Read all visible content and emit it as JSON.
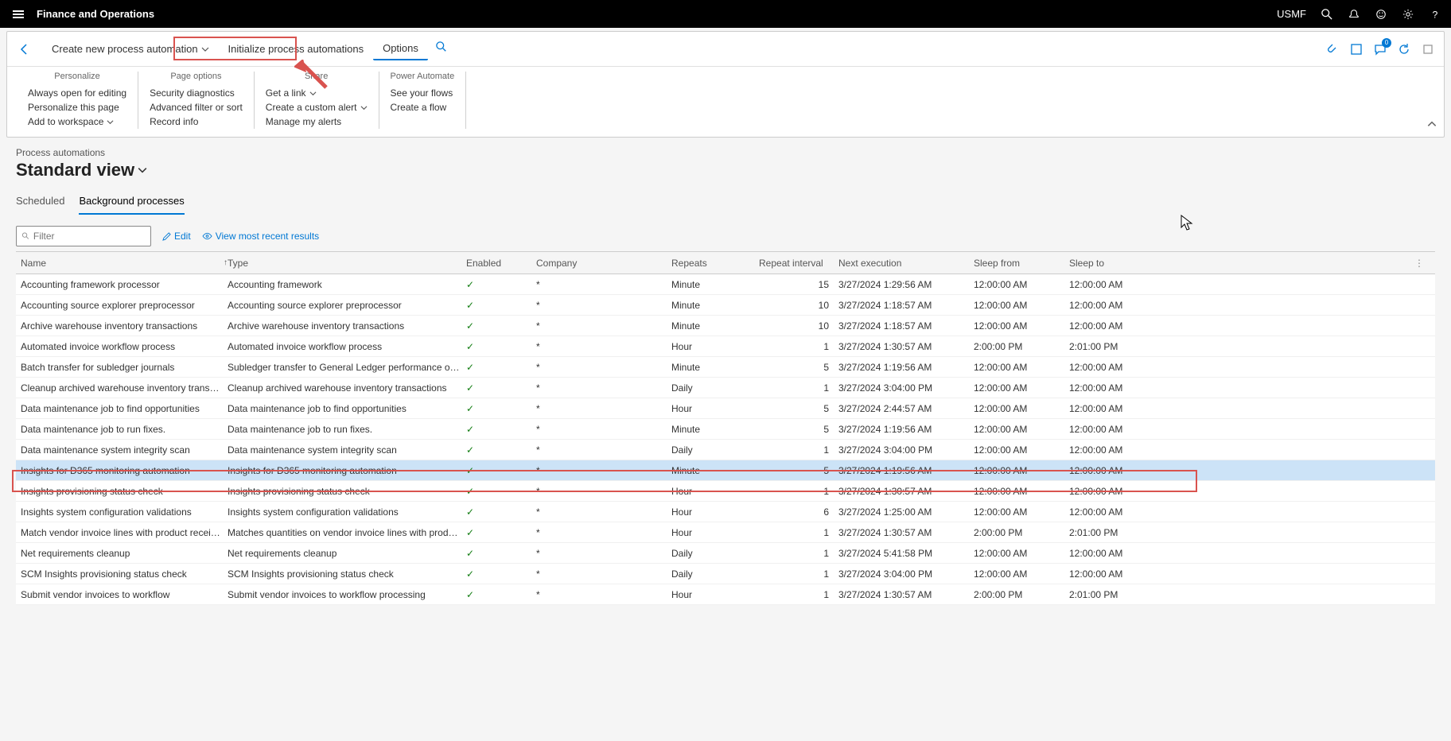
{
  "header": {
    "title": "Finance and Operations",
    "company": "USMF"
  },
  "actionPane": {
    "create": "Create new process automation",
    "initialize": "Initialize process automations",
    "options": "Options",
    "badge": "0"
  },
  "ribbon": {
    "personalize": {
      "title": "Personalize",
      "items": [
        "Always open for editing",
        "Personalize this page",
        "Add to workspace"
      ]
    },
    "pageOptions": {
      "title": "Page options",
      "items": [
        "Security diagnostics",
        "Advanced filter or sort",
        "Record info"
      ]
    },
    "share": {
      "title": "Share",
      "items": [
        "Get a link",
        "Create a custom alert",
        "Manage my alerts"
      ]
    },
    "powerAutomate": {
      "title": "Power Automate",
      "items": [
        "See your flows",
        "Create a flow"
      ]
    }
  },
  "body": {
    "breadcrumb": "Process automations",
    "viewTitle": "Standard view",
    "tabs": {
      "scheduled": "Scheduled",
      "background": "Background processes"
    },
    "filterPlaceholder": "Filter",
    "editLabel": "Edit",
    "recentLabel": "View most recent results"
  },
  "columns": {
    "name": "Name",
    "type": "Type",
    "enabled": "Enabled",
    "company": "Company",
    "repeats": "Repeats",
    "interval": "Repeat interval",
    "next": "Next execution",
    "sleepFrom": "Sleep from",
    "sleepTo": "Sleep to"
  },
  "rows": [
    {
      "name": "Accounting framework processor",
      "type": "Accounting framework",
      "enabled": true,
      "company": "*",
      "repeats": "Minute",
      "interval": "15",
      "next": "3/27/2024 1:29:56 AM",
      "sleepFrom": "12:00:00 AM",
      "sleepTo": "12:00:00 AM"
    },
    {
      "name": "Accounting source explorer preprocessor",
      "type": "Accounting source explorer preprocessor",
      "enabled": true,
      "company": "*",
      "repeats": "Minute",
      "interval": "10",
      "next": "3/27/2024 1:18:57 AM",
      "sleepFrom": "12:00:00 AM",
      "sleepTo": "12:00:00 AM"
    },
    {
      "name": "Archive warehouse inventory transactions",
      "type": "Archive warehouse inventory transactions",
      "enabled": true,
      "company": "*",
      "repeats": "Minute",
      "interval": "10",
      "next": "3/27/2024 1:18:57 AM",
      "sleepFrom": "12:00:00 AM",
      "sleepTo": "12:00:00 AM"
    },
    {
      "name": "Automated invoice workflow process",
      "type": "Automated invoice workflow process",
      "enabled": true,
      "company": "*",
      "repeats": "Hour",
      "interval": "1",
      "next": "3/27/2024 1:30:57 AM",
      "sleepFrom": "2:00:00 PM",
      "sleepTo": "2:01:00 PM"
    },
    {
      "name": "Batch transfer for subledger journals",
      "type": "Subledger transfer to General Ledger performance optimiza...",
      "enabled": true,
      "company": "*",
      "repeats": "Minute",
      "interval": "5",
      "next": "3/27/2024 1:19:56 AM",
      "sleepFrom": "12:00:00 AM",
      "sleepTo": "12:00:00 AM"
    },
    {
      "name": "Cleanup archived warehouse inventory transactions",
      "type": "Cleanup archived warehouse inventory transactions",
      "enabled": true,
      "company": "*",
      "repeats": "Daily",
      "interval": "1",
      "next": "3/27/2024 3:04:00 PM",
      "sleepFrom": "12:00:00 AM",
      "sleepTo": "12:00:00 AM"
    },
    {
      "name": "Data maintenance job to find opportunities",
      "type": "Data maintenance job to find opportunities",
      "enabled": true,
      "company": "*",
      "repeats": "Hour",
      "interval": "5",
      "next": "3/27/2024 2:44:57 AM",
      "sleepFrom": "12:00:00 AM",
      "sleepTo": "12:00:00 AM"
    },
    {
      "name": "Data maintenance job to run fixes.",
      "type": "Data maintenance job to run fixes.",
      "enabled": true,
      "company": "*",
      "repeats": "Minute",
      "interval": "5",
      "next": "3/27/2024 1:19:56 AM",
      "sleepFrom": "12:00:00 AM",
      "sleepTo": "12:00:00 AM"
    },
    {
      "name": "Data maintenance system integrity scan",
      "type": "Data maintenance system integrity scan",
      "enabled": true,
      "company": "*",
      "repeats": "Daily",
      "interval": "1",
      "next": "3/27/2024 3:04:00 PM",
      "sleepFrom": "12:00:00 AM",
      "sleepTo": "12:00:00 AM"
    },
    {
      "name": "Insights for D365 monitoring automation",
      "type": "Insights for D365 monitoring automation",
      "enabled": true,
      "company": "*",
      "repeats": "Minute",
      "interval": "5",
      "next": "3/27/2024 1:19:56 AM",
      "sleepFrom": "12:00:00 AM",
      "sleepTo": "12:00:00 AM",
      "highlighted": true
    },
    {
      "name": "Insights provisioning status check",
      "type": "Insights provisioning status check",
      "enabled": true,
      "company": "*",
      "repeats": "Hour",
      "interval": "1",
      "next": "3/27/2024 1:30:57 AM",
      "sleepFrom": "12:00:00 AM",
      "sleepTo": "12:00:00 AM"
    },
    {
      "name": "Insights system configuration validations",
      "type": "Insights system configuration validations",
      "enabled": true,
      "company": "*",
      "repeats": "Hour",
      "interval": "6",
      "next": "3/27/2024 1:25:00 AM",
      "sleepFrom": "12:00:00 AM",
      "sleepTo": "12:00:00 AM"
    },
    {
      "name": "Match vendor invoice lines with product receipts",
      "type": "Matches quantities on vendor invoice lines with product rec...",
      "enabled": true,
      "company": "*",
      "repeats": "Hour",
      "interval": "1",
      "next": "3/27/2024 1:30:57 AM",
      "sleepFrom": "2:00:00 PM",
      "sleepTo": "2:01:00 PM"
    },
    {
      "name": "Net requirements cleanup",
      "type": "Net requirements cleanup",
      "enabled": true,
      "company": "*",
      "repeats": "Daily",
      "interval": "1",
      "next": "3/27/2024 5:41:58 PM",
      "sleepFrom": "12:00:00 AM",
      "sleepTo": "12:00:00 AM"
    },
    {
      "name": "SCM Insights provisioning status check",
      "type": "SCM Insights provisioning status check",
      "enabled": true,
      "company": "*",
      "repeats": "Daily",
      "interval": "1",
      "next": "3/27/2024 3:04:00 PM",
      "sleepFrom": "12:00:00 AM",
      "sleepTo": "12:00:00 AM"
    },
    {
      "name": "Submit vendor invoices to workflow",
      "type": "Submit vendor invoices to workflow processing",
      "enabled": true,
      "company": "*",
      "repeats": "Hour",
      "interval": "1",
      "next": "3/27/2024 1:30:57 AM",
      "sleepFrom": "2:00:00 PM",
      "sleepTo": "2:01:00 PM"
    }
  ]
}
